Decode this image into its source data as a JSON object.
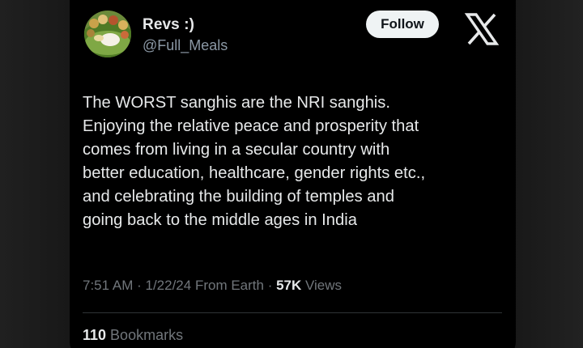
{
  "author": {
    "display_name": "Revs :)",
    "handle": "@Full_Meals",
    "avatar_icon": "food-plate-avatar"
  },
  "follow_label": "Follow",
  "brand_icon": "x-logo-icon",
  "tweet": {
    "lines": [
      "The WORST sanghis are the NRI sanghis.",
      "Enjoying the relative peace and prosperity that",
      "comes from living in a secular country with",
      "better education, healthcare, gender rights etc.,",
      "and celebrating the building of temples and",
      "going back to the middle ages in India"
    ]
  },
  "meta": {
    "time": "7:51 AM",
    "sep1": " · ",
    "date": "1/22/24",
    "source": " From Earth",
    "sep2": " · ",
    "views_count": "57K",
    "views_label": " Views"
  },
  "stats": {
    "bookmarks_count": "110",
    "bookmarks_label": " Bookmarks"
  },
  "colors": {
    "background": "#000000",
    "primary_text": "#e7e9ea",
    "secondary_text": "#71767b",
    "follow_bg": "#eff3f4"
  }
}
